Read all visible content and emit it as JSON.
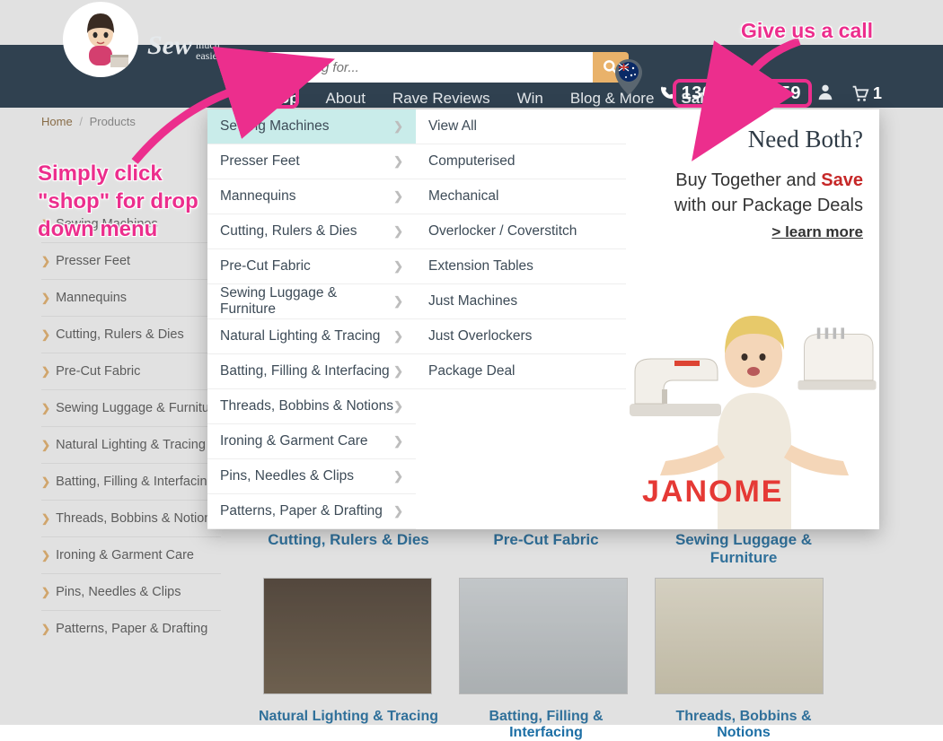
{
  "logo": {
    "word1": "Sew",
    "word2a": "much",
    "word2b": "easier"
  },
  "search": {
    "placeholder": "I'm looking for..."
  },
  "nav": {
    "shop": "Shop",
    "about": "About",
    "rave": "Rave Reviews",
    "win": "Win",
    "blog": "Blog & More",
    "sale": "Sale!"
  },
  "phone": "1300 88 11 59",
  "cartCount": "1",
  "breadcrumb": {
    "home": "Home",
    "products": "Products"
  },
  "sideCats": [
    "Sewing Machines",
    "Presser Feet",
    "Mannequins",
    "Cutting, Rulers & Dies",
    "Pre-Cut Fabric",
    "Sewing Luggage & Furniture",
    "Natural Lighting & Tracing",
    "Batting, Filling & Interfacing",
    "Threads, Bobbins & Notions",
    "Ironing & Garment Care",
    "Pins, Needles & Clips",
    "Patterns, Paper & Drafting"
  ],
  "megaCol1": [
    "Sewing Machines",
    "Presser Feet",
    "Mannequins",
    "Cutting, Rulers & Dies",
    "Pre-Cut Fabric",
    "Sewing Luggage & Furniture",
    "Natural Lighting & Tracing",
    "Batting, Filling & Interfacing",
    "Threads, Bobbins & Notions",
    "Ironing & Garment Care",
    "Pins, Needles & Clips",
    "Patterns, Paper & Drafting"
  ],
  "megaCol2": [
    "View All",
    "Computerised",
    "Mechanical",
    "Overlocker / Coverstitch",
    "Extension Tables",
    "Just Machines",
    "Just Overlockers",
    "Package Deal"
  ],
  "megaRight": {
    "heading": "Need Both?",
    "line1a": "Buy Together and ",
    "save": "Save",
    "line2": "with our Package Deals",
    "learn": "> learn more",
    "brand": "JANOME"
  },
  "row1Titles": [
    "Cutting, Rulers & Dies",
    "Pre-Cut Fabric",
    "Sewing Luggage & Furniture"
  ],
  "row2Titles": [
    "Natural Lighting & Tracing",
    "Batting, Filling & Interfacing",
    "Threads, Bobbins & Notions"
  ],
  "annot": {
    "call": "Give us a call",
    "shop": "Simply click \"shop\" for drop down menu"
  }
}
